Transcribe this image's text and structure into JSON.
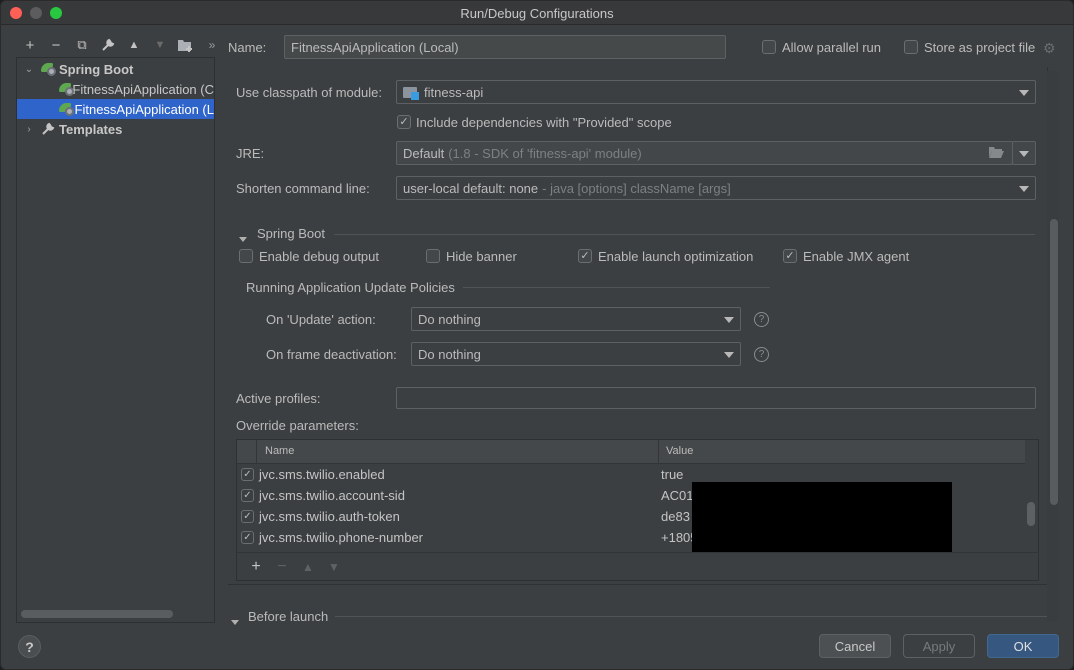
{
  "window": {
    "title": "Run/Debug Configurations"
  },
  "left_toolbar": {
    "icons": [
      "add-icon",
      "remove-icon",
      "copy-icon",
      "wrench-icon",
      "move-up-icon",
      "move-down-icon",
      "new-folder-icon",
      "more-icon"
    ],
    "glyphs": [
      "+",
      "−",
      "⧉",
      "🔧",
      "▲",
      "▼",
      "📁",
      "»"
    ]
  },
  "tree": {
    "items": [
      {
        "label": "Spring Boot",
        "level": 0,
        "expanded": true,
        "bold": true
      },
      {
        "label": "FitnessApiApplication (C",
        "level": 1
      },
      {
        "label": "FitnessApiApplication (L",
        "level": 1,
        "selected": true
      },
      {
        "label": "Templates",
        "level": 0,
        "expanded": false,
        "bold": true
      }
    ]
  },
  "header": {
    "name_label": "Name:",
    "name_value": "FitnessApiApplication (Local)",
    "allow_parallel_run": {
      "label": "Allow parallel run",
      "checked": false
    },
    "store_as_project_file": {
      "label": "Store as project file",
      "checked": false
    }
  },
  "form": {
    "classpath_label": "Use classpath of module:",
    "classpath_value": "fitness-api",
    "include_deps": {
      "label": "Include dependencies with \"Provided\" scope",
      "checked": true
    },
    "jre_label": "JRE:",
    "jre_value": "Default",
    "jre_hint": "(1.8 - SDK of 'fitness-api' module)",
    "shorten_label": "Shorten command line:",
    "shorten_value": "user-local default: none",
    "shorten_hint": "- java [options] className [args]"
  },
  "spring_boot": {
    "section_title": "Spring Boot",
    "options": [
      {
        "label": "Enable debug output",
        "checked": false
      },
      {
        "label": "Hide banner",
        "checked": false
      },
      {
        "label": "Enable launch optimization",
        "checked": true
      },
      {
        "label": "Enable JMX agent",
        "checked": true
      }
    ],
    "policies_title": "Running Application Update Policies",
    "on_update_label": "On 'Update' action:",
    "on_update_value": "Do nothing",
    "on_frame_label": "On frame deactivation:",
    "on_frame_value": "Do nothing",
    "active_profiles_label": "Active profiles:",
    "active_profiles_value": "",
    "override_label": "Override parameters:"
  },
  "override_table": {
    "columns": [
      "Name",
      "Value"
    ],
    "rows": [
      {
        "checked": true,
        "name": "jvc.sms.twilio.enabled",
        "value": "true"
      },
      {
        "checked": true,
        "name": "jvc.sms.twilio.account-sid",
        "value": "AC01"
      },
      {
        "checked": true,
        "name": "jvc.sms.twilio.auth-token",
        "value": "de83"
      },
      {
        "checked": true,
        "name": "jvc.sms.twilio.phone-number",
        "value": "+1805"
      }
    ],
    "toolbar": [
      "+",
      "−",
      "▲",
      "▼"
    ]
  },
  "before_launch": {
    "title": "Before launch"
  },
  "buttons": {
    "cancel": "Cancel",
    "apply": "Apply",
    "ok": "OK",
    "help": "?"
  }
}
